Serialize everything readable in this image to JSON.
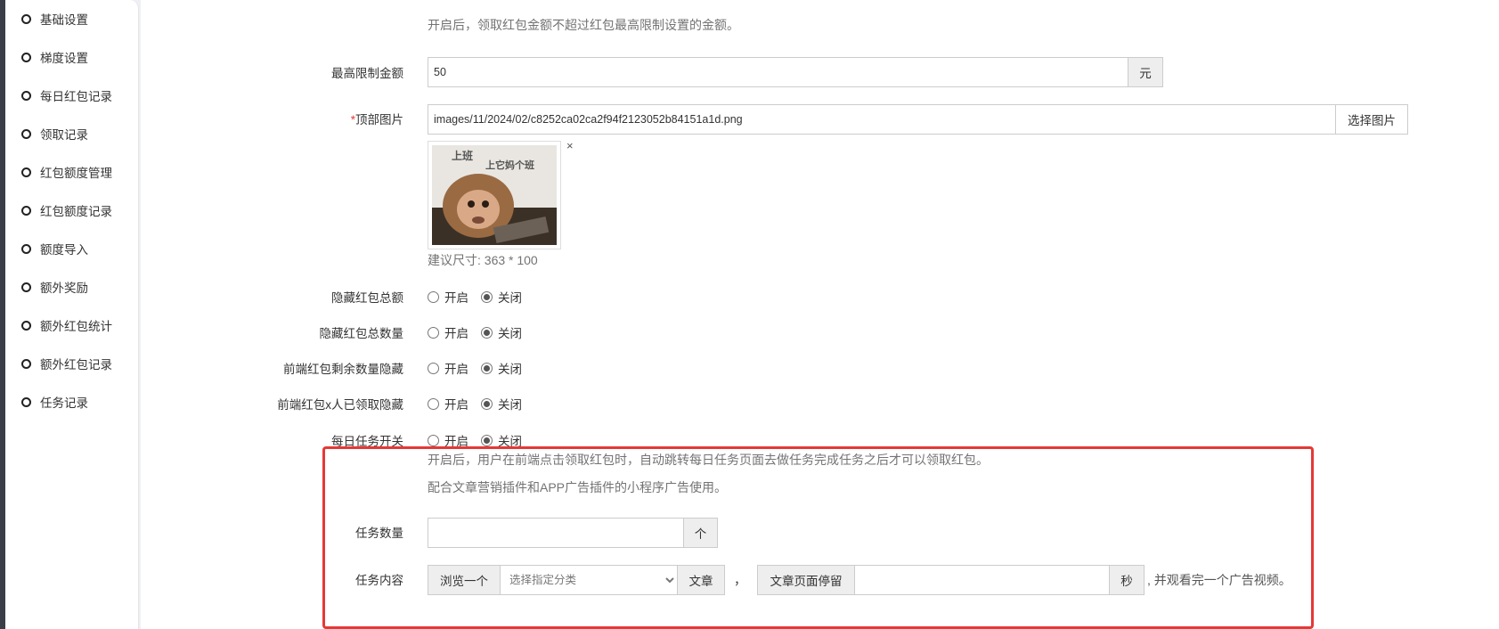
{
  "sidebar": {
    "items": [
      {
        "label": "基础设置"
      },
      {
        "label": "梯度设置"
      },
      {
        "label": "每日红包记录"
      },
      {
        "label": "领取记录"
      },
      {
        "label": "红包额度管理"
      },
      {
        "label": "红包额度记录"
      },
      {
        "label": "额度导入"
      },
      {
        "label": "额外奖励"
      },
      {
        "label": "额外红包统计"
      },
      {
        "label": "额外红包记录"
      },
      {
        "label": "任务记录"
      }
    ]
  },
  "form": {
    "top_help": "开启后，领取红包金额不超过红包最高限制设置的金额。",
    "max_amount": {
      "label": "最高限制金额",
      "value": "50",
      "unit": "元"
    },
    "top_image": {
      "required_mark": "*",
      "label": "顶部图片",
      "value": "images/11/2024/02/c8252ca02ca2f94f2123052b84151a1d.png",
      "button": "选择图片",
      "remove": "×",
      "thumb_caption_left": "上班",
      "thumb_caption_right": "上它妈个班",
      "hint": "建议尺寸: 363 * 100"
    },
    "radio_on": "开启",
    "radio_off": "关闭",
    "hide_total_amount": {
      "label": "隐藏红包总额"
    },
    "hide_total_count": {
      "label": "隐藏红包总数量"
    },
    "hide_remaining": {
      "label": "前端红包剩余数量隐藏"
    },
    "hide_received": {
      "label": "前端红包x人已领取隐藏"
    },
    "daily_task": {
      "label": "每日任务开关",
      "help1": "开启后，用户在前端点击领取红包时，自动跳转每日任务页面去做任务完成任务之后才可以领取红包。",
      "help2": "配合文章营销插件和APP广告插件的小程序广告使用。"
    },
    "task_count": {
      "label": "任务数量",
      "value": "",
      "unit": "个"
    },
    "task_content": {
      "label": "任务内容",
      "browse": "浏览一个",
      "category_placeholder": "选择指定分类",
      "article": "文章",
      "comma": "，",
      "stay_label": "文章页面停留",
      "stay_value": "",
      "seconds": "秒",
      "tail": ", 并观看完一个广告视频。"
    }
  },
  "colors": {
    "highlight": "#e53935",
    "required": "#e4393c"
  }
}
